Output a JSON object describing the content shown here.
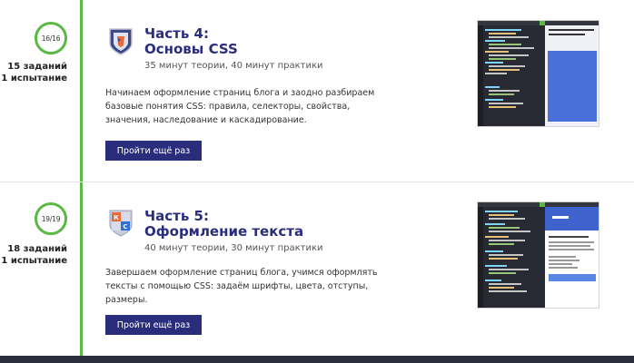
{
  "colors": {
    "accent_green": "#5ab945",
    "brand_navy": "#2a2d7c",
    "footer": "#2b2e3c"
  },
  "sections": [
    {
      "progress": "16/16",
      "tasks": "15 заданий",
      "tests": "1 испытание",
      "icon": "css-shield-icon",
      "title_line1": "Часть 4:",
      "title_line2": "Основы CSS",
      "meta": "35 минут теории, 40 минут практики",
      "desc": "Начинаем оформление страниц блога и заодно разбираем базовые понятия CSS: правила, селекторы, свойства, значения, наследование и каскадирование.",
      "button": "Пройти ещё раз"
    },
    {
      "progress": "19/19",
      "tasks": "18 заданий",
      "tests": "1 испытание",
      "icon": "ks-shield-icon",
      "title_line1": "Часть 5:",
      "title_line2": "Оформление текста",
      "meta": "40 минут теории, 30 минут практики",
      "desc": "Завершаем оформление страниц блога, учимся оформлять тексты с помощью CSS: задаём шрифты, цвета, отступы, размеры.",
      "button": "Пройти ещё раз"
    }
  ]
}
